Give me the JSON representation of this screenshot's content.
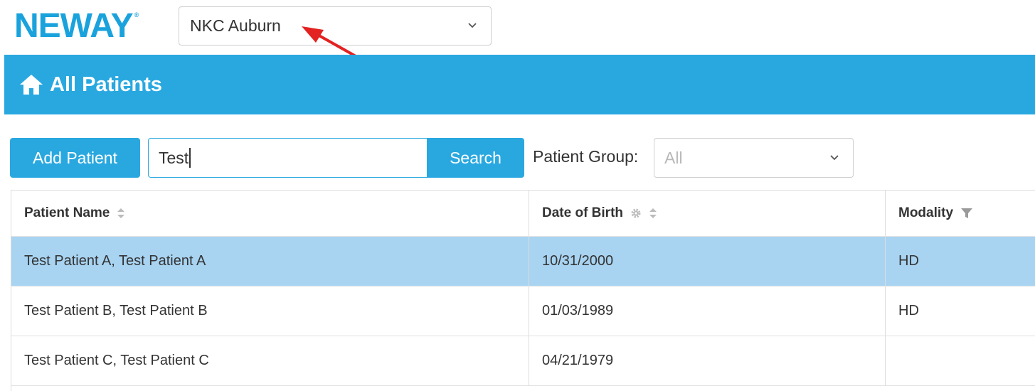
{
  "logo": {
    "text": "NEWAY"
  },
  "clinic_select": {
    "value": "NKC Auburn"
  },
  "banner": {
    "title": "All Patients",
    "icon": "home-icon"
  },
  "toolbar": {
    "add_label": "Add Patient",
    "search_value": "Test",
    "search_label": "Search",
    "group_label": "Patient Group:",
    "group_value": "All"
  },
  "table": {
    "columns": [
      {
        "label": "Patient Name",
        "icon": "sort-icon"
      },
      {
        "label": "Date of Birth",
        "icon": "gear-icon"
      },
      {
        "label": "Modality",
        "icon": "filter-icon"
      }
    ],
    "rows": [
      {
        "name": "Test Patient A, Test Patient A",
        "dob": "10/31/2000",
        "modality": "HD",
        "selected": true
      },
      {
        "name": "Test Patient B, Test Patient B",
        "dob": "01/03/1989",
        "modality": "HD",
        "selected": false
      },
      {
        "name": "Test Patient C, Test Patient C",
        "dob": "04/21/1979",
        "modality": "",
        "selected": false
      }
    ]
  },
  "colors": {
    "accent": "#29a8e0",
    "selected_row": "#a8d4f2",
    "annotation": "#e32222"
  }
}
